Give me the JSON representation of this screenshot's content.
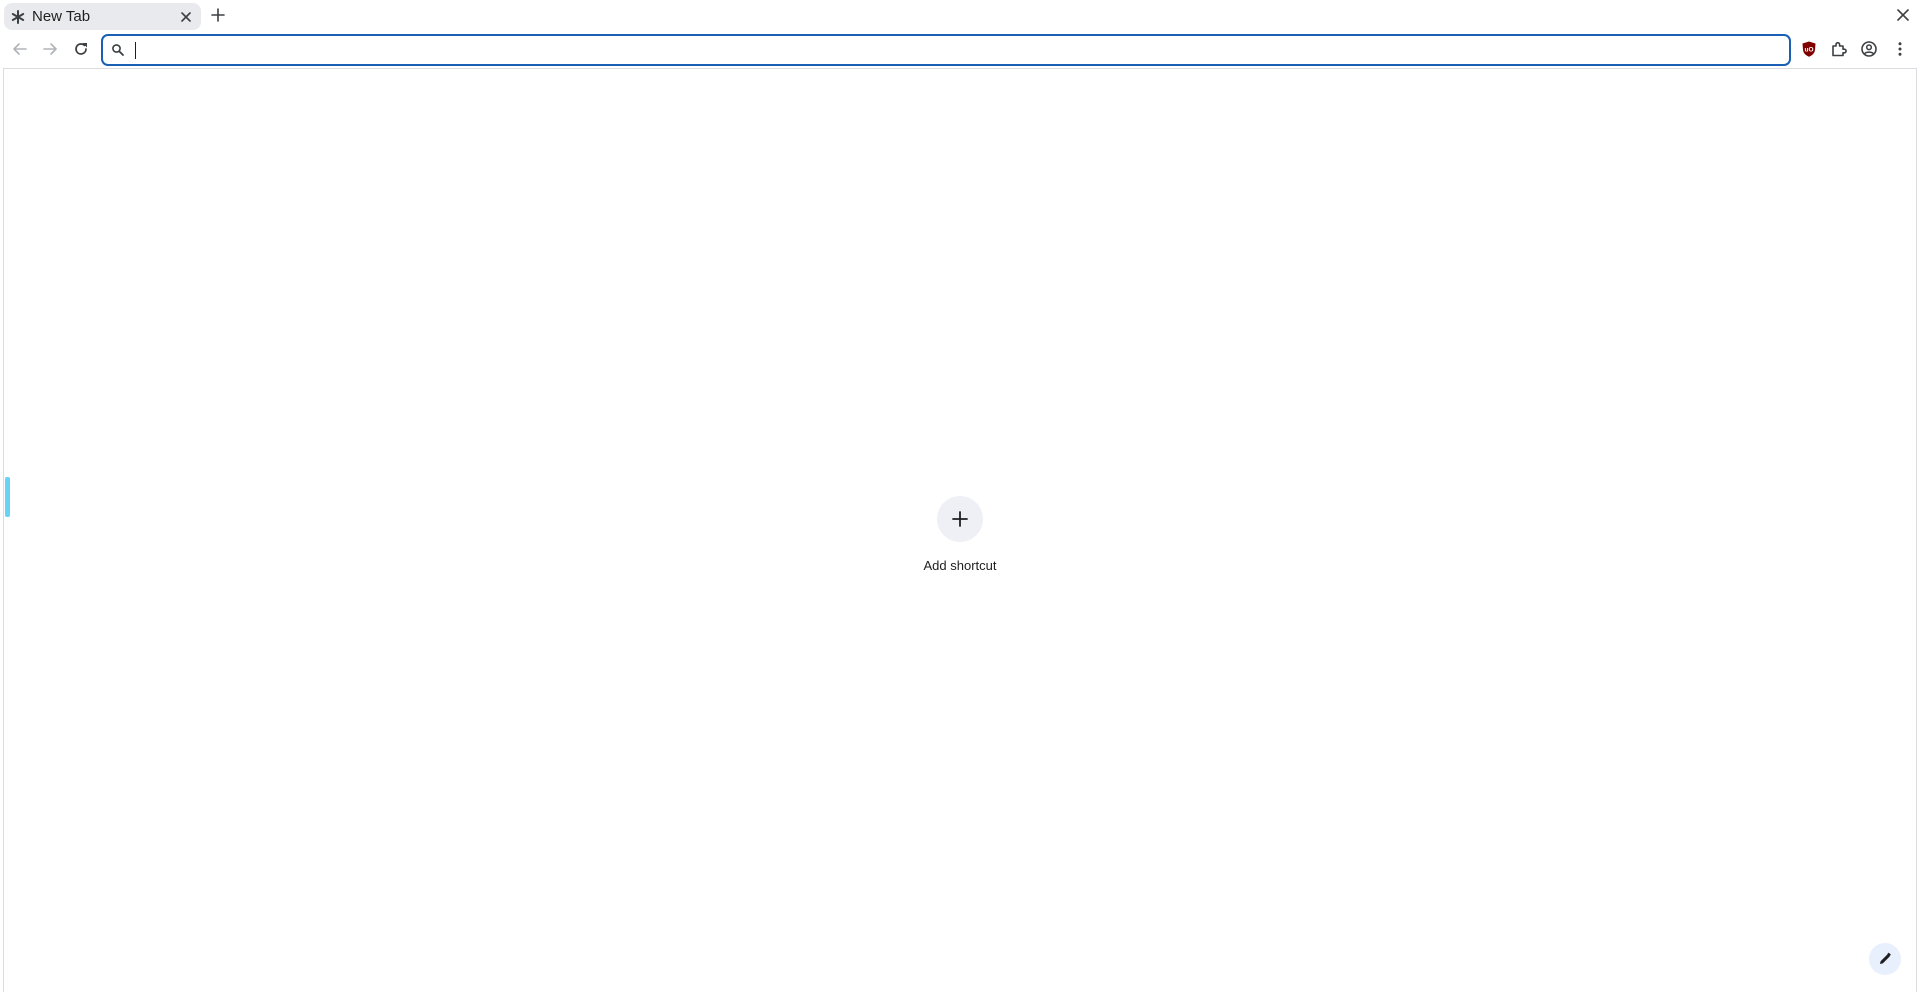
{
  "tabs": [
    {
      "title": "New Tab",
      "favicon": "asterisk-icon",
      "active": true
    }
  ],
  "toolbar": {
    "omnibox_value": "",
    "omnibox_placeholder": "",
    "icons": [
      "back-icon",
      "forward-icon",
      "reload-icon",
      "search-icon",
      "ublock-icon",
      "extensions-icon",
      "profile-icon",
      "menu-icon"
    ]
  },
  "ntp": {
    "add_shortcut_label": "Add shortcut",
    "customize_icon": "pencil-icon"
  },
  "colors": {
    "omnibox_border": "#1a5fb4",
    "ublock_red": "#800000",
    "shortcut_tile": "#eef0f5",
    "side_indicator": "#67d4f4"
  }
}
